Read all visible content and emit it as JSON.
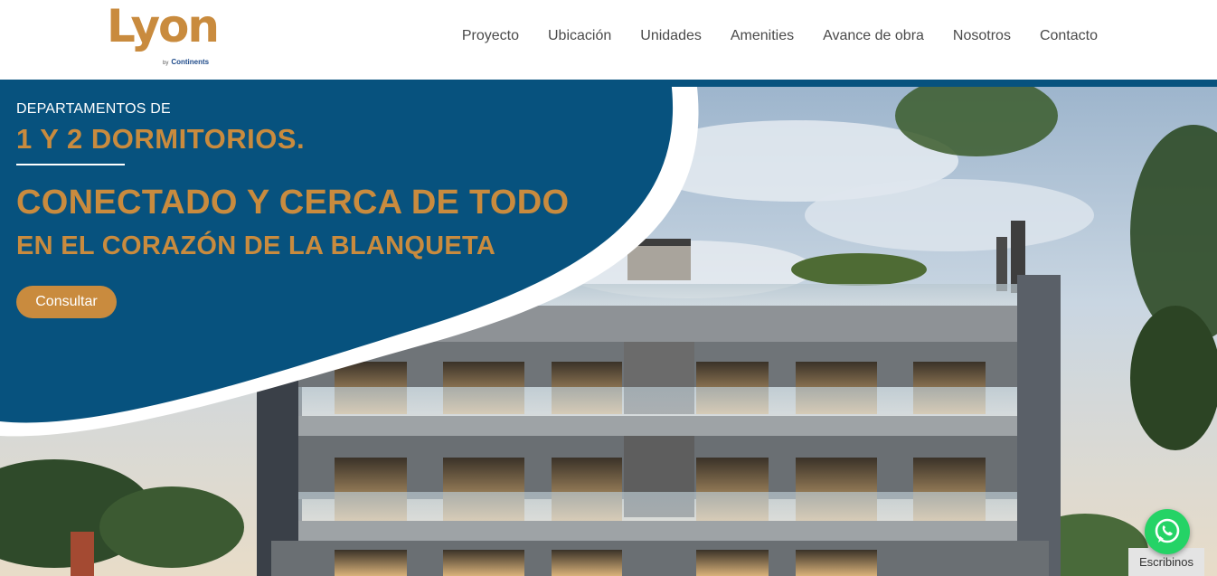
{
  "brand": {
    "logo_text": "Lyon",
    "logo_by": "by",
    "logo_company": "Continents",
    "logo_color": "#c98b3e"
  },
  "nav": {
    "items": [
      "Proyecto",
      "Ubicación",
      "Unidades",
      "Amenities",
      "Avance de obra",
      "Nosotros",
      "Contacto"
    ]
  },
  "hero": {
    "kicker": "DEPARTAMENTOS DE",
    "headline": "1 Y 2 DORMITORIOS.",
    "title": "CONECTADO Y CERCA DE TODO",
    "subtitle": "EN EL CORAZÓN DE LA BLANQUETA",
    "cta_label": "Consultar",
    "panel_color": "#07527e",
    "accent_color": "#c98b3e"
  },
  "chat": {
    "icon": "whatsapp-icon",
    "label": "Escribinos",
    "color": "#25d366"
  }
}
